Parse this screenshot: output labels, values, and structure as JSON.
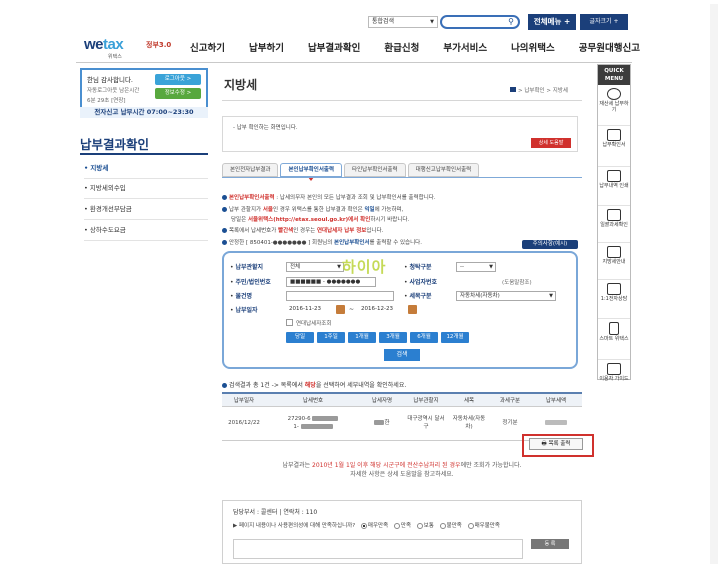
{
  "topbar": {
    "combined_search_label": "통합검색",
    "all_menu_label": "전체메뉴 +",
    "font_size_label": "글자크기 +"
  },
  "brand": {
    "logo_main": "we",
    "logo_tax": "tax",
    "logo_sub": "위택스",
    "logo_badge": "정부3.0"
  },
  "nav": [
    "신고하기",
    "납부하기",
    "납부결과확인",
    "환급신청",
    "부가서비스",
    "나의위택스",
    "공무원대행신고"
  ],
  "login": {
    "greeting": "한님 감사합니다.",
    "remain": "자동로그아웃 남은시간",
    "remain_time": "6분 29초 [연장]",
    "logout_label": "로그아웃 >",
    "info_label": "정보수정 >",
    "e_filing_time": "전자신고 납부시간 07:00~23:30"
  },
  "sidebar": {
    "title": "납부결과확인",
    "items": [
      {
        "label": "• 지방세"
      },
      {
        "label": "• 지방세외수입"
      },
      {
        "label": "• 환경개선부담금"
      },
      {
        "label": "• 상하수도요금"
      }
    ]
  },
  "page": {
    "title": "지방세",
    "breadcrumb": "> 납부확인 > 지방세",
    "notice": "- 납부 확인하는 화면입니다.",
    "detail_button": "상세 도움말"
  },
  "tabs": [
    "본인전자납부결과",
    "본인납부확인서출력",
    "타인납부확인서출력",
    "대행신고납부확인서출력"
  ],
  "bullets": {
    "b1": {
      "lead": "본인납부확인서출력",
      "rest": " : 납세의무자 본인의 모든 납부결과 조회 및 납부확인서를 출력합니다."
    },
    "b2": {
      "pre": "납부 관할지가 ",
      "city": "서울",
      "mid": "인 경우 위택스를 통한 납부결과 확인은 ",
      "hl": "익일",
      "post": "에 가능하며,"
    },
    "b2_sub": {
      "pre": "당일은 ",
      "hl": "서울위택스(http://etax.seoul.go.kr)에서 확인",
      "post": "하시기 바랍니다."
    },
    "b3": {
      "pre": "목록에서 납세번호가 ",
      "hl": "빨간색",
      "mid": "인 경우는 ",
      "hl2": "연대납세자 납부 정보",
      "post": "입니다."
    },
    "b4": {
      "pre": "안정한 [ 850401-●●●●●●● ] 회원님의 ",
      "hl": "본인납부확인서",
      "post": "를 출력할 수 있습니다."
    },
    "caution_label": "주의사항(예시)"
  },
  "form": {
    "tax_office_label": "납부관할지",
    "tax_office_value": "전체",
    "condition_label": "청탁구분",
    "condition_value": "--",
    "rrn_label": "주민/법인번호",
    "rrn_value": "■■■■■■ - ●●●●●●●",
    "bizno_label": "사업자번호",
    "bizno_note": "(도움말참조)",
    "item_label": "물건명",
    "taxtype_label": "세목구분",
    "taxtype_value": "자동차세(자동차)",
    "paydate_label": "납부일자",
    "date_from": "2016-11-23",
    "date_tilde": "~",
    "date_to": "2016-12-23",
    "joint_label": "연대납세자조회",
    "periods": [
      "당일",
      "1주일",
      "1개월",
      "3개월",
      "6개월",
      "12개월"
    ],
    "search_label": "검색",
    "watermark": "하이아"
  },
  "result": {
    "summary_pre": "검색결과 총 ",
    "count": "1건",
    "summary_mid": " -> 목록에서 ",
    "highlight": "해당",
    "summary_post": "을 선택하여 세부내역을 확인하세요.",
    "columns": [
      "납부일자",
      "납세번호",
      "납세자명",
      "납부관할지",
      "세목",
      "과세구분",
      "납부세액"
    ],
    "rows": [
      {
        "date": "2016/12/22",
        "taxno_top": "27290-6",
        "taxno_bottom": "1-",
        "name": "한",
        "office": "대구광역시 달서구",
        "taxitem": "자동차세(자동차)",
        "class": "정기분",
        "amount": ""
      }
    ],
    "print_label": "목록 출력"
  },
  "footnote": {
    "pre": "납부결과는 ",
    "hl": "2010년 1월 1일 이후 해당 시군구에 전산수납처리 된 경우",
    "post": "에만 조회가 가능합니다.",
    "line2": "자세한 사항은 상세 도움말을 참고하세요."
  },
  "survey": {
    "dept_label": "담당부서 : 콜센터",
    "sep": " | ",
    "contact_label": "연락처 : 110",
    "question": "▶ 페이지 내용이나 사용편의성에 대해 만족하십니까?",
    "options": [
      "매우만족",
      "만족",
      "보통",
      "불만족",
      "매우불만족"
    ],
    "submit_label": "등 록"
  },
  "quick_menu": {
    "title_line1": "QUICK",
    "title_line2": "MENU",
    "items": [
      {
        "label": "재산세 납부하기",
        "icon": "play-icon"
      },
      {
        "label": "납부확인서",
        "icon": "printer-icon"
      },
      {
        "label": "납부내역 인쇄",
        "icon": "document-icon"
      },
      {
        "label": "일괄과세확인",
        "icon": "calendar-icon"
      },
      {
        "label": "지방세안내",
        "icon": "book-icon"
      },
      {
        "label": "1:1전자상담",
        "icon": "chat-icon"
      },
      {
        "label": "스마트 위택스",
        "icon": "phone-icon"
      },
      {
        "label": "이용자 가이드",
        "icon": "guide-icon"
      }
    ]
  }
}
